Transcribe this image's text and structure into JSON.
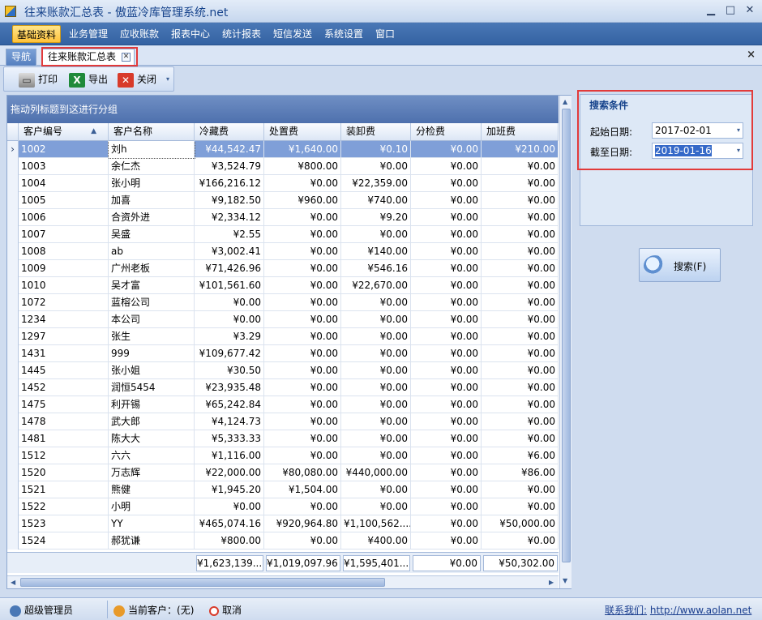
{
  "window": {
    "title": "往来账款汇总表 - 傲蓝冷库管理系统.net",
    "min": "▁",
    "max": "□",
    "close": "✕"
  },
  "menu": [
    "基础资料",
    "业务管理",
    "应收账款",
    "报表中心",
    "统计报表",
    "短信发送",
    "系统设置",
    "窗口"
  ],
  "tabs": {
    "nav": "导航",
    "summary": "往来账款汇总表",
    "close": "✕",
    "mdi_close": "×"
  },
  "toolbar": {
    "print": "打印",
    "export": "导出",
    "close": "关闭"
  },
  "grid": {
    "group_hint": "拖动列标题到这进行分组",
    "columns": [
      "客户编号",
      "客户名称",
      "冷藏费",
      "处置费",
      "装卸费",
      "分检费",
      "加班费"
    ],
    "sort_icon": "▲",
    "rows": [
      [
        "1002",
        "刘h",
        "¥44,542.47",
        "¥1,640.00",
        "¥0.10",
        "¥0.00",
        "¥210.00"
      ],
      [
        "1003",
        "余仁杰",
        "¥3,524.79",
        "¥800.00",
        "¥0.00",
        "¥0.00",
        "¥0.00"
      ],
      [
        "1004",
        "张小明",
        "¥166,216.12",
        "¥0.00",
        "¥22,359.00",
        "¥0.00",
        "¥0.00"
      ],
      [
        "1005",
        "加喜",
        "¥9,182.50",
        "¥960.00",
        "¥740.00",
        "¥0.00",
        "¥0.00"
      ],
      [
        "1006",
        "合资外进",
        "¥2,334.12",
        "¥0.00",
        "¥9.20",
        "¥0.00",
        "¥0.00"
      ],
      [
        "1007",
        "吴盛",
        "¥2.55",
        "¥0.00",
        "¥0.00",
        "¥0.00",
        "¥0.00"
      ],
      [
        "1008",
        "ab",
        "¥3,002.41",
        "¥0.00",
        "¥140.00",
        "¥0.00",
        "¥0.00"
      ],
      [
        "1009",
        "广州老板",
        "¥71,426.96",
        "¥0.00",
        "¥546.16",
        "¥0.00",
        "¥0.00"
      ],
      [
        "1010",
        "吴才富",
        "¥101,561.60",
        "¥0.00",
        "¥22,670.00",
        "¥0.00",
        "¥0.00"
      ],
      [
        "1072",
        "蓝榕公司",
        "¥0.00",
        "¥0.00",
        "¥0.00",
        "¥0.00",
        "¥0.00"
      ],
      [
        "1234",
        "本公司",
        "¥0.00",
        "¥0.00",
        "¥0.00",
        "¥0.00",
        "¥0.00"
      ],
      [
        "1297",
        "张生",
        "¥3.29",
        "¥0.00",
        "¥0.00",
        "¥0.00",
        "¥0.00"
      ],
      [
        "1431",
        "999",
        "¥109,677.42",
        "¥0.00",
        "¥0.00",
        "¥0.00",
        "¥0.00"
      ],
      [
        "1445",
        "张小姐",
        "¥30.50",
        "¥0.00",
        "¥0.00",
        "¥0.00",
        "¥0.00"
      ],
      [
        "1452",
        "润恒5454",
        "¥23,935.48",
        "¥0.00",
        "¥0.00",
        "¥0.00",
        "¥0.00"
      ],
      [
        "1475",
        "利开锡",
        "¥65,242.84",
        "¥0.00",
        "¥0.00",
        "¥0.00",
        "¥0.00"
      ],
      [
        "1478",
        "武大郎",
        "¥4,124.73",
        "¥0.00",
        "¥0.00",
        "¥0.00",
        "¥0.00"
      ],
      [
        "1481",
        "陈大大",
        "¥5,333.33",
        "¥0.00",
        "¥0.00",
        "¥0.00",
        "¥0.00"
      ],
      [
        "1512",
        "六六",
        "¥1,116.00",
        "¥0.00",
        "¥0.00",
        "¥0.00",
        "¥6.00"
      ],
      [
        "1520",
        "万志辉",
        "¥22,000.00",
        "¥80,080.00",
        "¥440,000.00",
        "¥0.00",
        "¥86.00"
      ],
      [
        "1521",
        "熊健",
        "¥1,945.20",
        "¥1,504.00",
        "¥0.00",
        "¥0.00",
        "¥0.00"
      ],
      [
        "1522",
        "小明",
        "¥0.00",
        "¥0.00",
        "¥0.00",
        "¥0.00",
        "¥0.00"
      ],
      [
        "1523",
        "YY",
        "¥465,074.16",
        "¥920,964.80",
        "¥1,100,562....",
        "¥0.00",
        "¥50,000.00"
      ],
      [
        "1524",
        "郝犹谦",
        "¥800.00",
        "¥0.00",
        "¥400.00",
        "¥0.00",
        "¥0.00"
      ]
    ],
    "totals": [
      "¥1,623,139....",
      "¥1,019,097.96",
      "¥1,595,401....",
      "¥0.00",
      "¥50,302.00"
    ],
    "row_indicator": "›"
  },
  "search": {
    "title": "搜索条件",
    "start_label": "起始日期:",
    "start_value": "2017-02-01",
    "end_label": "截至日期:",
    "end_value": "2019-01-16",
    "button": "搜索(F)",
    "dropdown": "▾"
  },
  "status": {
    "user": "超级管理员",
    "current_customer_label": "当前客户：",
    "current_customer_value": "(无)",
    "cancel": "取消",
    "contact_label": "联系我们:",
    "contact_url": "http://www.aolan.net"
  },
  "colors": {
    "accent": "#4a78b6",
    "selected_row": "#7f9fd8",
    "highlight_box": "#e23a3a"
  }
}
